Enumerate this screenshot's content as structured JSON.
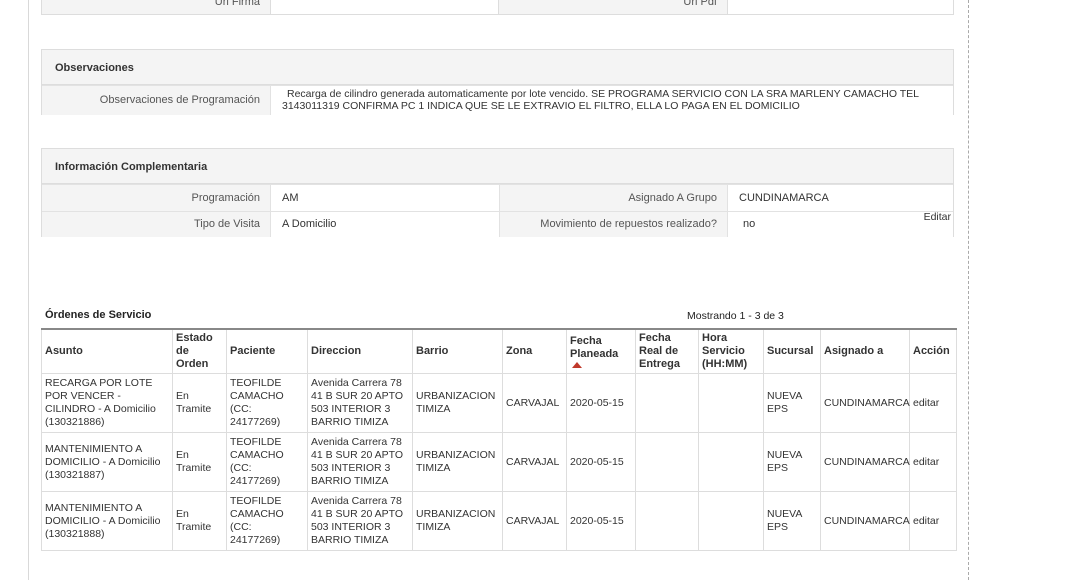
{
  "top_form": {
    "url_firma_label": "Url Firma",
    "url_pdf_label": "Url Pdf"
  },
  "observaciones": {
    "title": "Observaciones",
    "label": "Observaciones de Programación",
    "value": "Recarga de cilindro generada automaticamente por lote vencido. SE PROGRAMA SERVICIO CON LA SRA MARLENY CAMACHO TEL 3143011319 CONFIRMA PC 1 INDICA QUE SE LE EXTRAVIO EL FILTRO, ELLA LO PAGA EN EL DOMICILIO"
  },
  "info": {
    "title": "Información Complementaria",
    "programacion_label": "Programación",
    "programacion_value": "AM",
    "grupo_label": "Asignado A Grupo",
    "grupo_value": "CUNDINAMARCA",
    "tipo_label": "Tipo de Visita",
    "tipo_value": "A Domicilio",
    "mov_label": "Movimiento de repuestos realizado?",
    "mov_value": "no",
    "edit_label": "Editar"
  },
  "orders": {
    "title": "Órdenes de Servicio",
    "count": "Mostrando 1 - 3 de 3",
    "headers": [
      "Asunto",
      "Estado de Orden",
      "Paciente",
      "Direccion",
      "Barrio",
      "Zona",
      "Fecha Planeada",
      "Fecha Real de Entrega",
      "Hora Servicio (HH:MM)",
      "Sucursal",
      "Asignado a",
      "Acción"
    ],
    "rows": [
      {
        "asunto": "RECARGA POR LOTE POR VENCER - CILINDRO - A Domicilio (130321886)",
        "estado": "En Tramite",
        "paciente": "TEOFILDE CAMACHO (CC: 24177269)",
        "direccion": "Avenida Carrera 78 41 B SUR 20 APTO 503 INTERIOR 3 BARRIO TIMIZA",
        "barrio": "URBANIZACION TIMIZA",
        "zona": "CARVAJAL",
        "fecha_planeada": "2020-05-15",
        "fecha_real": "",
        "hora": "",
        "sucursal": "NUEVA EPS",
        "asignado": "CUNDINAMARCA",
        "accion": "editar"
      },
      {
        "asunto": "MANTENIMIENTO A DOMICILIO - A Domicilio (130321887)",
        "estado": "En Tramite",
        "paciente": "TEOFILDE CAMACHO (CC: 24177269)",
        "direccion": "Avenida Carrera 78 41 B SUR 20 APTO 503 INTERIOR 3 BARRIO TIMIZA",
        "barrio": "URBANIZACION TIMIZA",
        "zona": "CARVAJAL",
        "fecha_planeada": "2020-05-15",
        "fecha_real": "",
        "hora": "",
        "sucursal": "NUEVA EPS",
        "asignado": "CUNDINAMARCA",
        "accion": "editar"
      },
      {
        "asunto": "MANTENIMIENTO A DOMICILIO - A Domicilio (130321888)",
        "estado": "En Tramite",
        "paciente": "TEOFILDE CAMACHO (CC: 24177269)",
        "direccion": "Avenida Carrera 78 41 B SUR 20 APTO 503 INTERIOR 3 BARRIO TIMIZA",
        "barrio": "URBANIZACION TIMIZA",
        "zona": "CARVAJAL",
        "fecha_planeada": "2020-05-15",
        "fecha_real": "",
        "hora": "",
        "sucursal": "NUEVA EPS",
        "asignado": "CUNDINAMARCA",
        "accion": "editar"
      }
    ]
  },
  "colors": {
    "sort_arrow": "#c0392b",
    "panel_header_bg": "#f4f4f4",
    "border": "#dddddd"
  },
  "icons": {
    "sort_indicator": "sort-ascending-icon"
  }
}
